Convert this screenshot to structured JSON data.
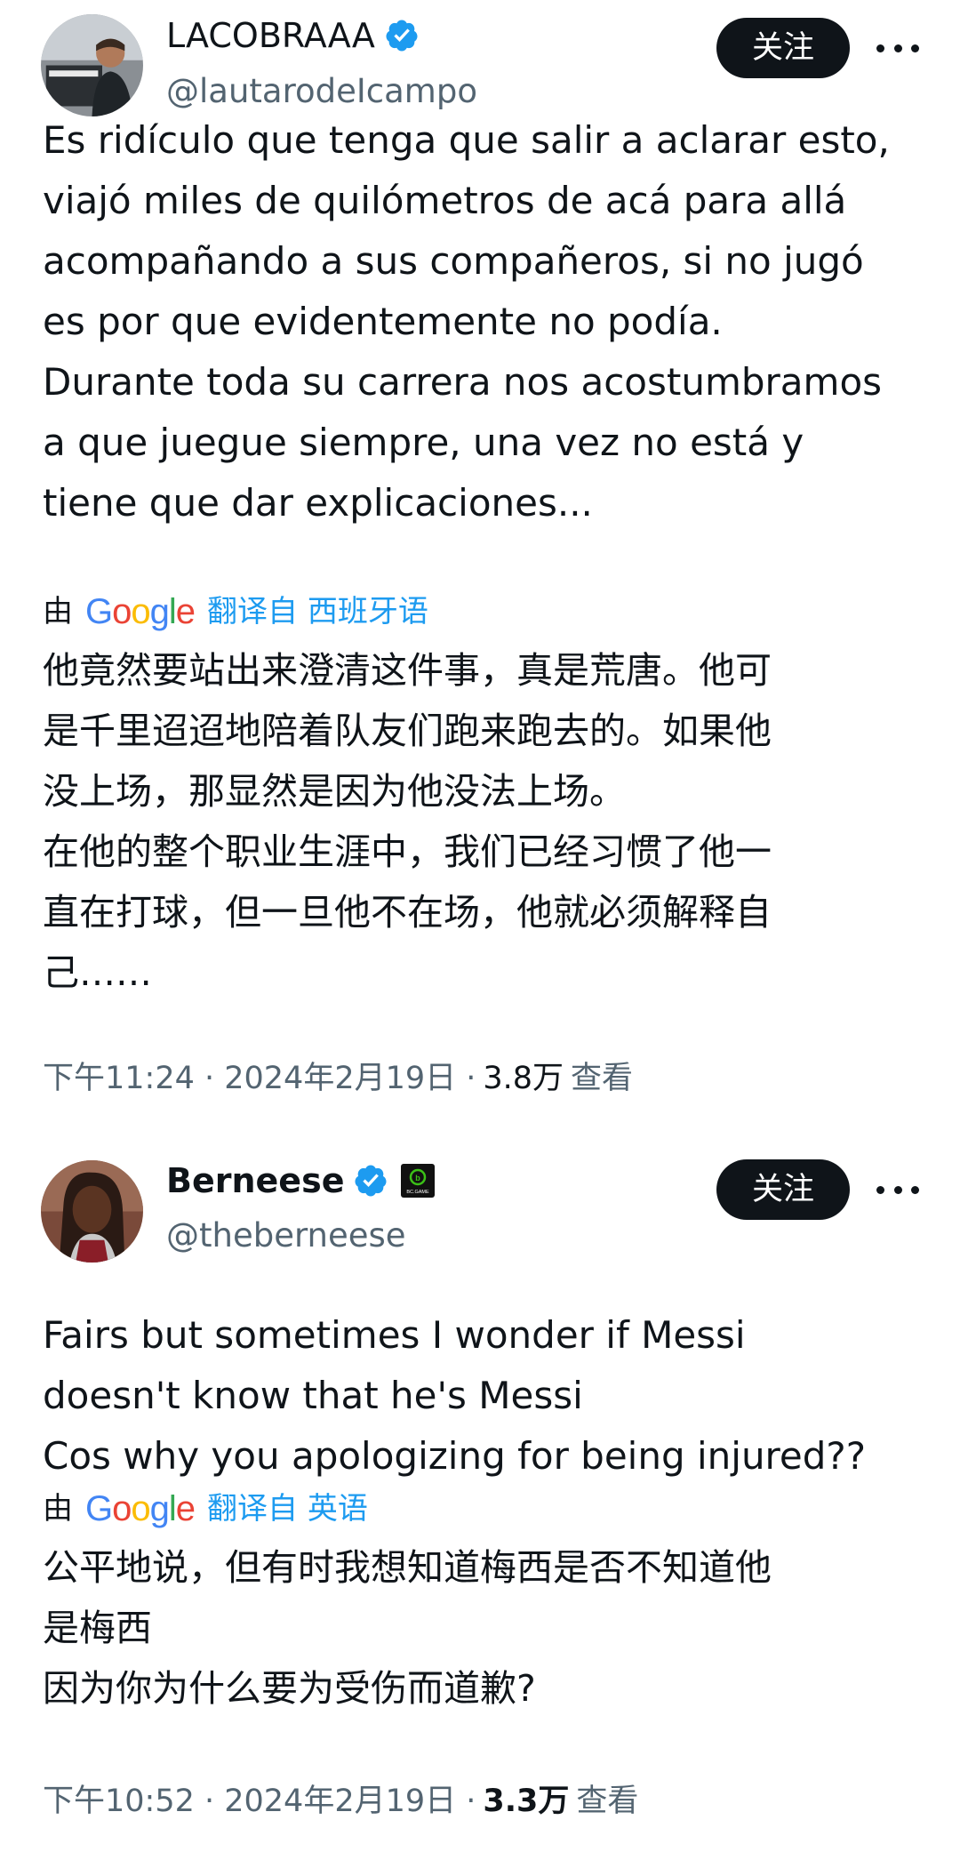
{
  "tweets": [
    {
      "display_name": "LACOBRAAA",
      "handle": "@lautarodeIcampo",
      "follow_label": "关注",
      "text": "Es ridículo que tenga que salir a aclarar esto,\nviajó miles de quilómetros de acá para allá\nacompañando a sus compañeros, si no jugó\nes por que evidentemente no podía.\nDurante toda su carrera nos acostumbramos\na que juegue siempre, una vez no está y\ntiene que dar explicaciones...",
      "translate_by": "由",
      "translate_label": "翻译自 西班牙语",
      "translated_text": "他竟然要站出来澄清这件事，真是荒唐。他可\n是千里迢迢地陪着队友们跑来跑去的。如果他\n没上场，那显然是因为他没法上场。\n在他的整个职业生涯中，我们已经习惯了他一\n直在打球，但一旦他不在场，他就必须解释自\n己……",
      "timestamp": "下午11:24 · 2024年2月19日 ·",
      "views_count": "3.8万",
      "views_label": "查看",
      "icons": {
        "verified": "verified-badge-icon",
        "more": "more-options-icon"
      }
    },
    {
      "display_name": "Berneese",
      "handle": "@theberneese",
      "follow_label": "关注",
      "affiliate_badge_text": "BC.GAME",
      "text": "Fairs but sometimes I wonder if Messi\ndoesn't know that he's Messi\nCos why you apologizing for being injured??",
      "translate_by": "由",
      "translate_label": "翻译自 英语",
      "translated_text": "公平地说，但有时我想知道梅西是否不知道他\n是梅西\n因为你为什么要为受伤而道歉?",
      "timestamp": "下午10:52 · 2024年2月19日 ·",
      "views_count": "3.3万",
      "views_label": "查看",
      "icons": {
        "verified": "verified-badge-icon",
        "affiliate": "bc-game-affiliate-icon",
        "more": "more-options-icon"
      }
    }
  ],
  "google_logo": {
    "G": "G",
    "o1": "o",
    "o2": "o",
    "g": "g",
    "l": "l",
    "e": "e"
  },
  "colors": {
    "text_primary": "#0f1419",
    "text_secondary": "#536471",
    "link_blue": "#1d9bf0",
    "verified_blue": "#1d9bf0",
    "button_dark": "#0f1419",
    "connector": "#cfd9de"
  }
}
